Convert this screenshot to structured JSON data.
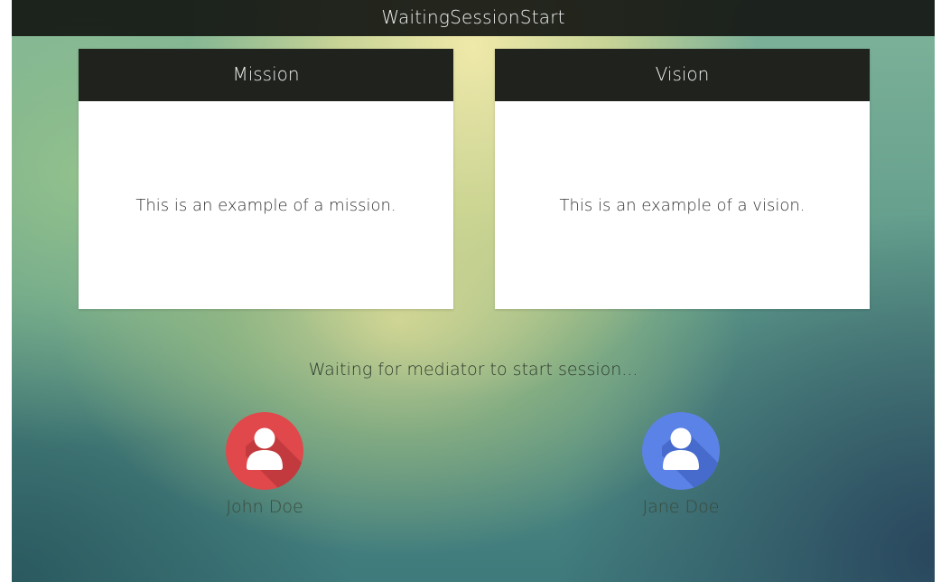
{
  "window": {
    "title": "WaitingSessionStart"
  },
  "cards": {
    "mission": {
      "title": "Mission",
      "text": "This is an example of a mission."
    },
    "vision": {
      "title": "Vision",
      "text": "This is an example of a vision."
    }
  },
  "status": {
    "text": "Waiting for mediator to start session..."
  },
  "participants": [
    {
      "name": "John Doe",
      "avatar_icon": "user-icon",
      "avatar_color": "#e0484b"
    },
    {
      "name": "Jane Doe",
      "avatar_icon": "user-icon",
      "avatar_color": "#5b82e6"
    }
  ]
}
